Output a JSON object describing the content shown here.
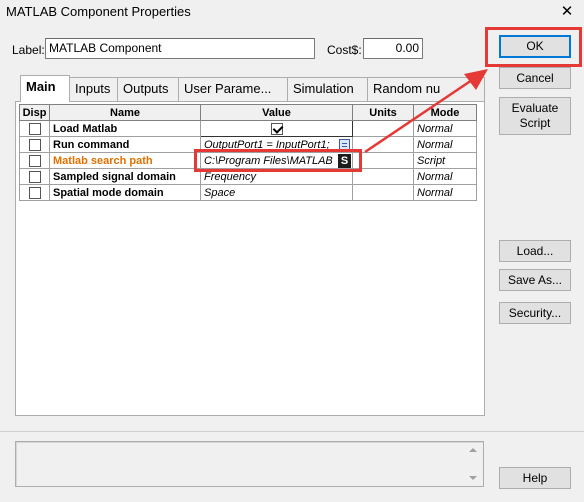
{
  "window": {
    "title": "MATLAB Component Properties",
    "close_glyph": "✕"
  },
  "header": {
    "label_caption": "Label:",
    "label_value": "MATLAB Component",
    "cost_caption": "Cost$:",
    "cost_value": "0.00"
  },
  "tabs": [
    {
      "label": "Main",
      "active": true
    },
    {
      "label": "Inputs"
    },
    {
      "label": "Outputs"
    },
    {
      "label": "User Parame..."
    },
    {
      "label": "Simulation"
    },
    {
      "label": "Random nu"
    }
  ],
  "grid": {
    "columns": [
      "Disp",
      "Name",
      "Value",
      "Units",
      "Mode"
    ],
    "rows": [
      {
        "disp": false,
        "name": "Load Matlab",
        "value": "",
        "value_checkbox": true,
        "units": "",
        "mode": "Normal"
      },
      {
        "disp": false,
        "name": "Run command",
        "value": "OutputPort1 = InputPort1;",
        "value_icon": "list-icon",
        "units": "",
        "mode": "Normal"
      },
      {
        "disp": false,
        "name": "Matlab search path",
        "value": "C:\\Program Files\\MATLAB",
        "value_icon": "script-icon",
        "script_glyph": "S",
        "units": "",
        "mode": "Script",
        "highlight_color": "#e07000"
      },
      {
        "disp": false,
        "name": "Sampled signal domain",
        "value": "Frequency",
        "units": "",
        "mode": "Normal"
      },
      {
        "disp": false,
        "name": "Spatial mode domain",
        "value": "Space",
        "units": "",
        "mode": "Normal"
      }
    ]
  },
  "buttons": {
    "ok": "OK",
    "cancel": "Cancel",
    "evaluate_line1": "Evaluate",
    "evaluate_line2": "Script",
    "load": "Load...",
    "save_as": "Save As...",
    "security": "Security...",
    "help": "Help"
  },
  "annotations": {
    "color": "#e53935"
  }
}
